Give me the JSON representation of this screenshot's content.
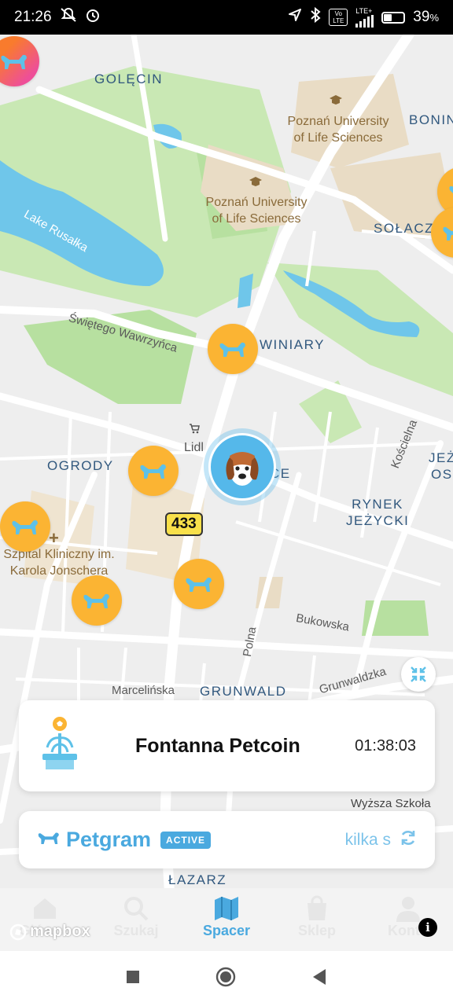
{
  "status_bar": {
    "time": "21:26",
    "network_label": "LTE+",
    "volte_label": "Vo LTE",
    "battery_percent": "39",
    "battery_suffix": "%",
    "battery_level": 0.39
  },
  "map": {
    "districts": [
      "GOLĘCIN",
      "BONIN",
      "SOŁACZ",
      "WINIARY",
      "OGRODY",
      "RYNEK JEŻYCKI",
      "JEŻ",
      "OSI",
      "GRUNWALD",
      "ŁAZARZ"
    ],
    "pois": [
      "Poznań University of Life Sciences",
      "Poznań University of Life Sciences",
      "Lidl",
      "Szpital Kliniczny im. Karola Jonschera",
      "Wyższa Szkoła"
    ],
    "streets": [
      "Świętego Wawrzyńca",
      "Kościelna",
      "Polna",
      "Bukowska",
      "Grunwaldzka",
      "Marcelińska"
    ],
    "water_labels": [
      "Lake Rusałka"
    ],
    "road_shield": "433",
    "partial_label": "CE",
    "colors": {
      "pin": "#fbb433",
      "park": "#c9e8b4",
      "water": "#6fc6ea",
      "campus": "#e9dcc5"
    },
    "attribution": "mapbox"
  },
  "fountain_card": {
    "title": "Fontanna Petcoin",
    "timer": "01:38:03",
    "icon": "fountain-icon"
  },
  "petgram_card": {
    "logo_text": "Petgram",
    "badge": "ACTIVE",
    "status_text": "kilka s",
    "refresh_icon": "refresh-icon"
  },
  "navbar": {
    "items": [
      {
        "label": "Główna",
        "icon": "home-icon"
      },
      {
        "label": "Szukaj",
        "icon": "search-icon"
      },
      {
        "label": "Spacer",
        "icon": "map-icon",
        "active": true
      },
      {
        "label": "Sklep",
        "icon": "bag-icon"
      },
      {
        "label": "Konto",
        "icon": "user-icon"
      }
    ],
    "accent": "#4aa9df"
  }
}
